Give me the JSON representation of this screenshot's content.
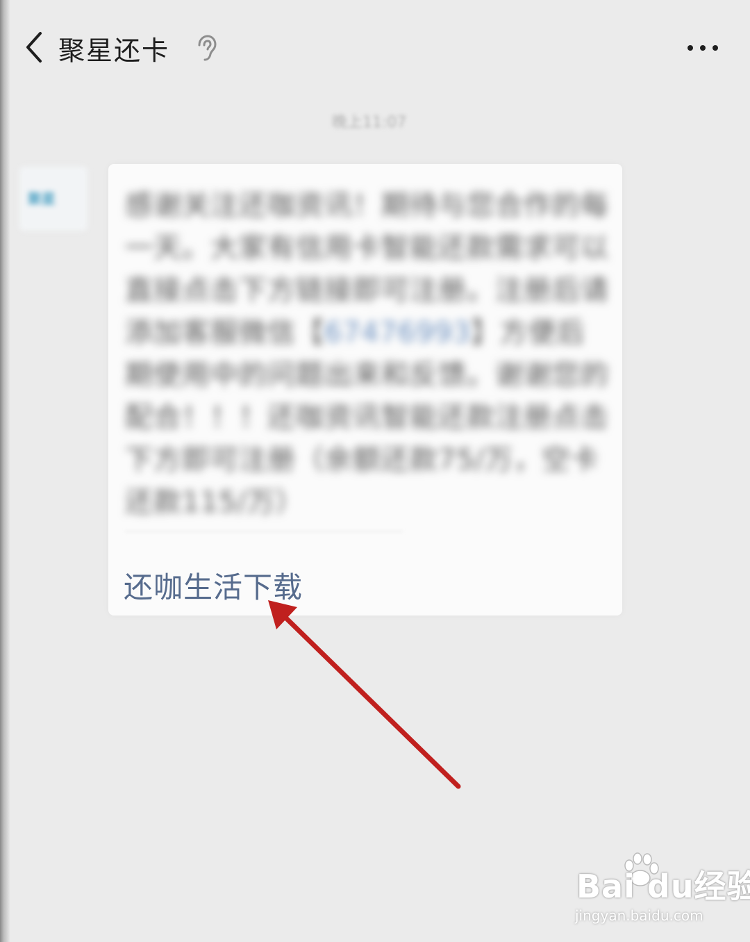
{
  "header": {
    "title": "聚星还卡",
    "back_icon": "chevron-left-icon",
    "mode_icon": "ear-icon",
    "menu_icon": "more-dots-icon"
  },
  "chat": {
    "timestamp": "晚上11:07",
    "avatar_label": "聚星",
    "message": {
      "body_part1": "感谢关注还咖资讯！期待与您合作的每一天。大家有信用卡智能还款需求可以直接点击下方链接即可注册。注册后请添加客服微信【",
      "wechat_id": "67476993",
      "body_part2": "】方便后期使用中的问题出来和反馈。谢谢您的配合！！！还咖资讯智能还款注册点击下方即可注册（余额还款75/万，空卡还款115/万）",
      "link_label": "还咖生活下载"
    }
  },
  "annotation": {
    "arrow_color": "#c0201e"
  },
  "watermark": {
    "brand_text": "Bai  du经验",
    "url": "jingyan.baidu.com"
  }
}
